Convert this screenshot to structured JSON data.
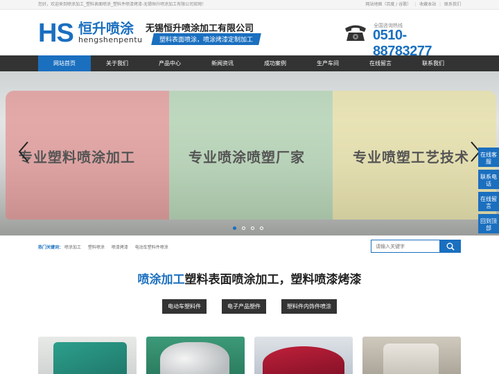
{
  "topbar": {
    "welcome": "您好，欢迎来到喷涂加工_塑料表面喷涂_塑料件喷漆烤漆-无锡恒升喷涂加工有限公司官网！",
    "sitemap": "网站地图（百度 / 谷歌）",
    "sep": "|",
    "bookmark": "收藏本站",
    "contact": "联系我们"
  },
  "header": {
    "logo_mark": "HS",
    "logo_cn": "恒升喷涂",
    "logo_en": "hengshenpentu",
    "company_name": "无锡恒升喷涂加工有限公司",
    "slogan": "塑料表面喷涂，喷涂烤漆定制加工",
    "hotline_label": "全国咨询热线",
    "hotline": "0510-88783277"
  },
  "nav": {
    "items": [
      "网站首页",
      "关于我们",
      "产品中心",
      "新闻资讯",
      "成功案例",
      "生产车间",
      "在线留言",
      "联系我们"
    ]
  },
  "banner": {
    "texts": [
      "专业塑料喷涂加工",
      "专业喷涂喷塑厂家",
      "专业喷塑工艺技术"
    ]
  },
  "sidefloat": {
    "items": [
      "在线客服",
      "联系电话",
      "在线留言",
      "回到顶部"
    ]
  },
  "hot": {
    "label": "热门关键词：",
    "keywords": [
      "喷涂加工",
      "塑料喷涂",
      "喷漆烤漆",
      "电动车塑料件喷涂"
    ]
  },
  "search": {
    "placeholder": "请输入关键字"
  },
  "section": {
    "title_blue": "喷涂加工",
    "title_rest": "塑料表面喷涂加工，塑料喷漆烤漆"
  },
  "tags": [
    "电动车塑料件",
    "电子产品塑件",
    "塑料件内饰件喷涂"
  ],
  "colors": {
    "primary": "#1a6fbf",
    "nav_bg": "#333333"
  }
}
